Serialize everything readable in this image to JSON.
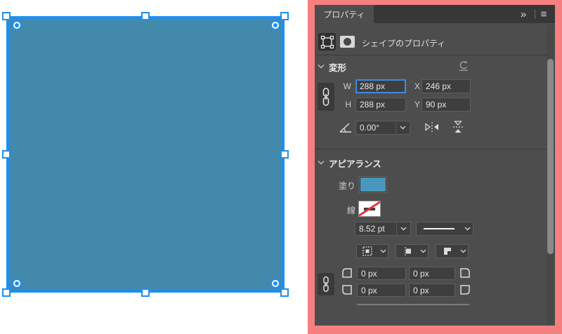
{
  "colors": {
    "frame-red": "#f5807f",
    "panel-bg": "#4d4d4d",
    "strip-bg": "#373737",
    "field-bg": "#3e3e3e",
    "field-border": "#5f5f5f",
    "focus-blue": "#3f8ae2",
    "shape-fill": "#4289ac",
    "selection-blue": "#1e8fef",
    "swatch-blue": "#4a97bd"
  },
  "panel": {
    "tab_title": "プロパティ",
    "collapse_glyph": "»",
    "menu_glyph": "≡",
    "shape_props_title": "シェイプのプロパティ",
    "transform": {
      "title": "変形",
      "w_label": "W",
      "w_value": "288 px",
      "x_label": "X",
      "x_value": "246 px",
      "h_label": "H",
      "h_value": "288 px",
      "y_label": "Y",
      "y_value": "90 px",
      "angle_value": "0.00°"
    },
    "appearance": {
      "title": "アピアランス",
      "fill_label": "塗り",
      "stroke_label": "線",
      "stroke_width_value": "8.52 pt",
      "corner_tl_value": "0 px",
      "corner_tr_value": "0 px",
      "corner_bl_value": "0 px",
      "corner_br_value": "0 px"
    }
  }
}
